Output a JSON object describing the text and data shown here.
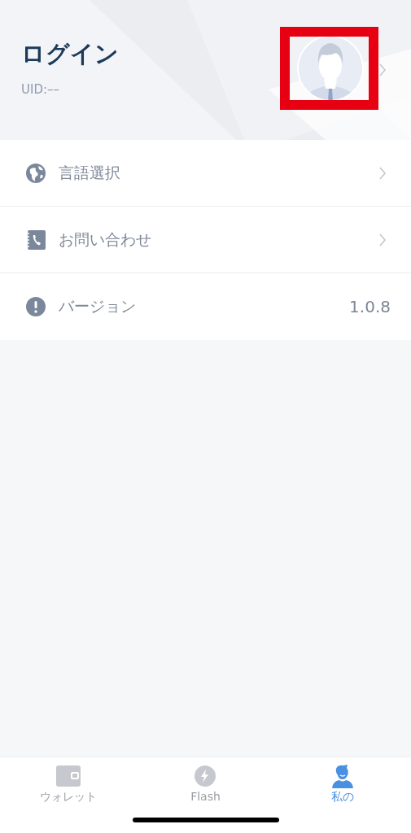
{
  "header": {
    "title": "ログイン",
    "uid": "UID:––",
    "avatar_highlighted": true
  },
  "menu": [
    {
      "kind": "link",
      "label": "言語選択"
    },
    {
      "kind": "link",
      "label": "お問い合わせ"
    },
    {
      "kind": "value",
      "label": "バージョン",
      "value": "1.0.8"
    }
  ],
  "tabs": [
    {
      "label": "ウォレット",
      "selected": false
    },
    {
      "label": "Flash",
      "selected": false
    },
    {
      "label": "私の",
      "selected": true
    }
  ]
}
